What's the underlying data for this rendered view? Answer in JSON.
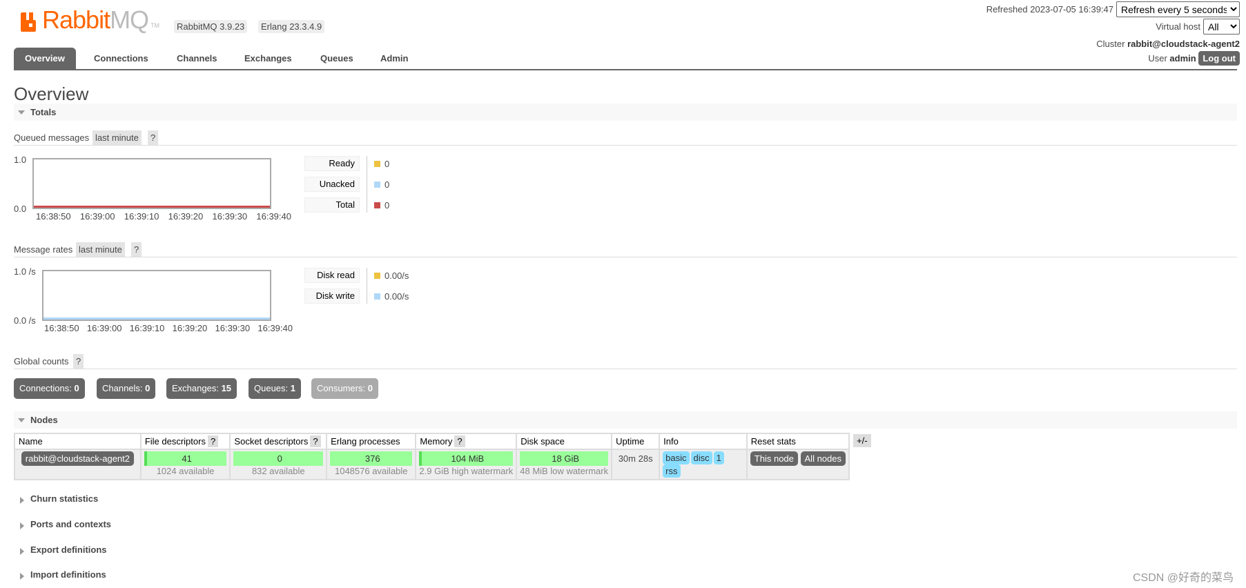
{
  "header": {
    "logo_text_1": "Rabbit",
    "logo_text_2": "MQ",
    "logo_tm": "TM",
    "rabbitmq_version": "RabbitMQ 3.9.23",
    "erlang_version": "Erlang 23.3.4.9",
    "refreshed_label": "Refreshed 2023-07-05 16:39:47",
    "refresh_select": "Refresh every 5 seconds",
    "vhost_label": "Virtual host",
    "vhost_select": "All",
    "cluster_label": "Cluster",
    "cluster_name": "rabbit@cloudstack-agent2",
    "user_label": "User",
    "user_name": "admin",
    "logout": "Log out"
  },
  "tabs": [
    {
      "label": "Overview",
      "active": true
    },
    {
      "label": "Connections"
    },
    {
      "label": "Channels"
    },
    {
      "label": "Exchanges"
    },
    {
      "label": "Queues"
    },
    {
      "label": "Admin"
    }
  ],
  "page_title": "Overview",
  "totals": {
    "title": "Totals",
    "queued": {
      "label": "Queued messages",
      "range": "last minute",
      "help": "?",
      "y_top": "1.0",
      "y_bottom": "0.0",
      "x_ticks": [
        "16:38:50",
        "16:39:00",
        "16:39:10",
        "16:39:20",
        "16:39:30",
        "16:39:40"
      ],
      "legend": [
        {
          "label": "Ready",
          "value": "0",
          "color": "#edc240"
        },
        {
          "label": "Unacked",
          "value": "0",
          "color": "#afd8f8"
        },
        {
          "label": "Total",
          "value": "0",
          "color": "#cb4b4b"
        }
      ]
    },
    "rates": {
      "label": "Message rates",
      "range": "last minute",
      "help": "?",
      "y_top": "1.0 /s",
      "y_bottom": "0.0 /s",
      "x_ticks": [
        "16:38:50",
        "16:39:00",
        "16:39:10",
        "16:39:20",
        "16:39:30",
        "16:39:40"
      ],
      "legend": [
        {
          "label": "Disk read",
          "value": "0.00/s",
          "color": "#edc240"
        },
        {
          "label": "Disk write",
          "value": "0.00/s",
          "color": "#afd8f8"
        }
      ]
    },
    "global": {
      "label": "Global counts",
      "help": "?",
      "counts": [
        {
          "label": "Connections:",
          "value": "0"
        },
        {
          "label": "Channels:",
          "value": "0"
        },
        {
          "label": "Exchanges:",
          "value": "15"
        },
        {
          "label": "Queues:",
          "value": "1"
        },
        {
          "label": "Consumers:",
          "value": "0"
        }
      ]
    }
  },
  "nodes": {
    "title": "Nodes",
    "plus_minus": "+/-",
    "columns": [
      "Name",
      "File descriptors",
      "Socket descriptors",
      "Erlang processes",
      "Memory",
      "Disk space",
      "Uptime",
      "Info",
      "Reset stats"
    ],
    "help": "?",
    "row": {
      "name": "rabbit@cloudstack-agent2",
      "fd": "41",
      "fd_avail": "1024 available",
      "sd": "0",
      "sd_avail": "832 available",
      "procs": "376",
      "procs_avail": "1048576 available",
      "mem": "104 MiB",
      "mem_wm": "2.9 GiB high watermark",
      "disk": "18 GiB",
      "disk_wm": "48 MiB low watermark",
      "uptime": "30m 28s",
      "info": [
        "basic",
        "disc",
        "1",
        "rss"
      ],
      "reset_this": "This node",
      "reset_all": "All nodes"
    }
  },
  "collapsed": [
    "Churn statistics",
    "Ports and contexts",
    "Export definitions",
    "Import definitions"
  ],
  "watermark": "CSDN @好奇的菜鸟"
}
